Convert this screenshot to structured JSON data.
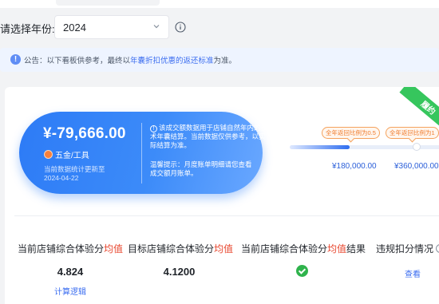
{
  "filter": {
    "label": "请选择年份:",
    "year_value": "2024"
  },
  "notice": {
    "prefix": "公告：以下看板供参考，最终以",
    "link": "年囊折扣优惠的返还标准",
    "suffix": "为准。"
  },
  "summary": {
    "amount": "¥-79,666.00",
    "category": "五金/工具",
    "updated_line1": "当前数据统计更新至",
    "updated_line2": "2024-04-22",
    "note": "该成交额数据用于店铺自然年内的技术年囊结算。当前数据仅供参考，以实际结算为准。",
    "tip": "温馨提示：月度账单明细请您查看成交额月账单。"
  },
  "ribbon": {
    "label": "履约"
  },
  "progress": {
    "fill_fraction": 0.39,
    "tags": [
      "全年返回比例为0.5",
      "全年返回比例为1"
    ],
    "markers": [
      "¥180,000.00",
      "¥360,000.00"
    ]
  },
  "metrics": [
    {
      "label_prefix": "当前店铺综合体验分",
      "label_highlight": "均值",
      "label_suffix": "",
      "value": "4.824",
      "link": "计算逻辑"
    },
    {
      "label_prefix": "目标店铺综合体验分",
      "label_highlight": "均值",
      "label_suffix": "",
      "value": "4.1200"
    },
    {
      "label_prefix": "当前店铺综合体验分",
      "label_highlight": "均值",
      "label_suffix": "结果",
      "status": "pass"
    },
    {
      "label": "违规扣分情况",
      "link": "查看"
    }
  ],
  "colors": {
    "accent_blue": "#2d7bf6",
    "highlight_red": "#e8472f",
    "success_green": "#2fb34c",
    "tag_orange": "#f07b2b"
  }
}
